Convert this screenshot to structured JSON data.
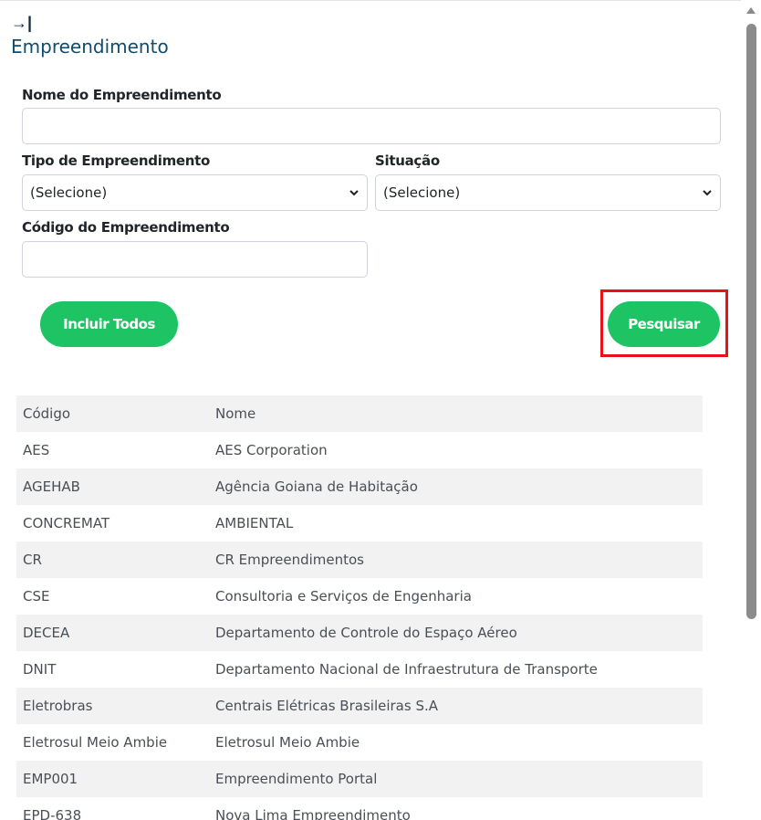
{
  "header": {
    "collapse_icon": "arrow-right-to-line-icon",
    "collapse_glyph": "→|",
    "title": "Empreendimento"
  },
  "form": {
    "nome_label": "Nome do Empreendimento",
    "nome_value": "",
    "tipo_label": "Tipo de Empreendimento",
    "tipo_selected": "(Selecione)",
    "situacao_label": "Situação",
    "situacao_selected": "(Selecione)",
    "codigo_label": "Código do Empreendimento",
    "codigo_value": ""
  },
  "buttons": {
    "incluir_todos": "Incluir Todos",
    "pesquisar": "Pesquisar"
  },
  "colors": {
    "accent_green": "#1ec463",
    "highlight_red": "#e8101a",
    "title_blue": "#0f4c6e"
  },
  "table": {
    "headers": [
      "Código",
      "Nome"
    ],
    "rows": [
      [
        "AES",
        "AES Corporation"
      ],
      [
        "AGEHAB",
        "Agência Goiana de Habitação"
      ],
      [
        "CONCREMAT",
        "AMBIENTAL"
      ],
      [
        "CR",
        "CR Empreendimentos"
      ],
      [
        "CSE",
        "Consultoria e Serviços de Engenharia"
      ],
      [
        "DECEA",
        "Departamento de Controle do Espaço Aéreo"
      ],
      [
        "DNIT",
        "Departamento Nacional de Infraestrutura de Transporte"
      ],
      [
        "Eletrobras",
        "Centrais Elétricas Brasileiras S.A"
      ],
      [
        "Eletrosul Meio Ambie",
        "Eletrosul Meio Ambie"
      ],
      [
        "EMP001",
        "Empreendimento Portal"
      ],
      [
        "EPD-638",
        "Nova Lima Empreendimento"
      ]
    ]
  }
}
